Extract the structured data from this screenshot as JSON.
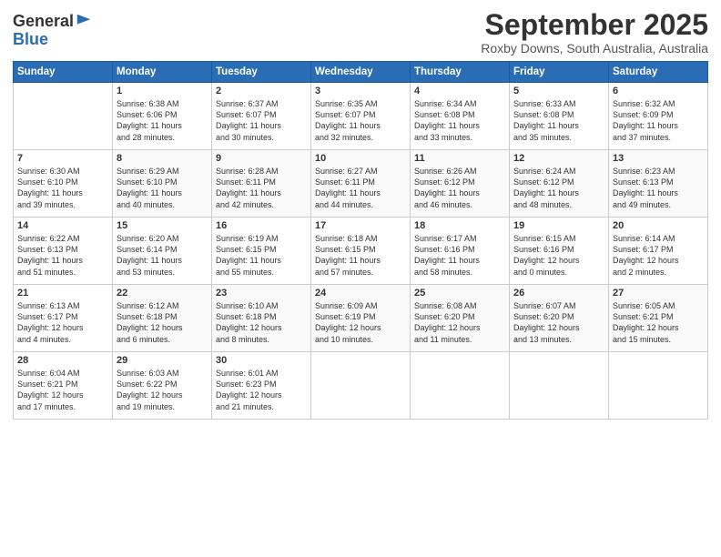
{
  "logo": {
    "general": "General",
    "blue": "Blue"
  },
  "title": "September 2025",
  "location": "Roxby Downs, South Australia, Australia",
  "days_of_week": [
    "Sunday",
    "Monday",
    "Tuesday",
    "Wednesday",
    "Thursday",
    "Friday",
    "Saturday"
  ],
  "weeks": [
    [
      {
        "day": "",
        "info": ""
      },
      {
        "day": "1",
        "info": "Sunrise: 6:38 AM\nSunset: 6:06 PM\nDaylight: 11 hours\nand 28 minutes."
      },
      {
        "day": "2",
        "info": "Sunrise: 6:37 AM\nSunset: 6:07 PM\nDaylight: 11 hours\nand 30 minutes."
      },
      {
        "day": "3",
        "info": "Sunrise: 6:35 AM\nSunset: 6:07 PM\nDaylight: 11 hours\nand 32 minutes."
      },
      {
        "day": "4",
        "info": "Sunrise: 6:34 AM\nSunset: 6:08 PM\nDaylight: 11 hours\nand 33 minutes."
      },
      {
        "day": "5",
        "info": "Sunrise: 6:33 AM\nSunset: 6:08 PM\nDaylight: 11 hours\nand 35 minutes."
      },
      {
        "day": "6",
        "info": "Sunrise: 6:32 AM\nSunset: 6:09 PM\nDaylight: 11 hours\nand 37 minutes."
      }
    ],
    [
      {
        "day": "7",
        "info": "Sunrise: 6:30 AM\nSunset: 6:10 PM\nDaylight: 11 hours\nand 39 minutes."
      },
      {
        "day": "8",
        "info": "Sunrise: 6:29 AM\nSunset: 6:10 PM\nDaylight: 11 hours\nand 40 minutes."
      },
      {
        "day": "9",
        "info": "Sunrise: 6:28 AM\nSunset: 6:11 PM\nDaylight: 11 hours\nand 42 minutes."
      },
      {
        "day": "10",
        "info": "Sunrise: 6:27 AM\nSunset: 6:11 PM\nDaylight: 11 hours\nand 44 minutes."
      },
      {
        "day": "11",
        "info": "Sunrise: 6:26 AM\nSunset: 6:12 PM\nDaylight: 11 hours\nand 46 minutes."
      },
      {
        "day": "12",
        "info": "Sunrise: 6:24 AM\nSunset: 6:12 PM\nDaylight: 11 hours\nand 48 minutes."
      },
      {
        "day": "13",
        "info": "Sunrise: 6:23 AM\nSunset: 6:13 PM\nDaylight: 11 hours\nand 49 minutes."
      }
    ],
    [
      {
        "day": "14",
        "info": "Sunrise: 6:22 AM\nSunset: 6:13 PM\nDaylight: 11 hours\nand 51 minutes."
      },
      {
        "day": "15",
        "info": "Sunrise: 6:20 AM\nSunset: 6:14 PM\nDaylight: 11 hours\nand 53 minutes."
      },
      {
        "day": "16",
        "info": "Sunrise: 6:19 AM\nSunset: 6:15 PM\nDaylight: 11 hours\nand 55 minutes."
      },
      {
        "day": "17",
        "info": "Sunrise: 6:18 AM\nSunset: 6:15 PM\nDaylight: 11 hours\nand 57 minutes."
      },
      {
        "day": "18",
        "info": "Sunrise: 6:17 AM\nSunset: 6:16 PM\nDaylight: 11 hours\nand 58 minutes."
      },
      {
        "day": "19",
        "info": "Sunrise: 6:15 AM\nSunset: 6:16 PM\nDaylight: 12 hours\nand 0 minutes."
      },
      {
        "day": "20",
        "info": "Sunrise: 6:14 AM\nSunset: 6:17 PM\nDaylight: 12 hours\nand 2 minutes."
      }
    ],
    [
      {
        "day": "21",
        "info": "Sunrise: 6:13 AM\nSunset: 6:17 PM\nDaylight: 12 hours\nand 4 minutes."
      },
      {
        "day": "22",
        "info": "Sunrise: 6:12 AM\nSunset: 6:18 PM\nDaylight: 12 hours\nand 6 minutes."
      },
      {
        "day": "23",
        "info": "Sunrise: 6:10 AM\nSunset: 6:18 PM\nDaylight: 12 hours\nand 8 minutes."
      },
      {
        "day": "24",
        "info": "Sunrise: 6:09 AM\nSunset: 6:19 PM\nDaylight: 12 hours\nand 10 minutes."
      },
      {
        "day": "25",
        "info": "Sunrise: 6:08 AM\nSunset: 6:20 PM\nDaylight: 12 hours\nand 11 minutes."
      },
      {
        "day": "26",
        "info": "Sunrise: 6:07 AM\nSunset: 6:20 PM\nDaylight: 12 hours\nand 13 minutes."
      },
      {
        "day": "27",
        "info": "Sunrise: 6:05 AM\nSunset: 6:21 PM\nDaylight: 12 hours\nand 15 minutes."
      }
    ],
    [
      {
        "day": "28",
        "info": "Sunrise: 6:04 AM\nSunset: 6:21 PM\nDaylight: 12 hours\nand 17 minutes."
      },
      {
        "day": "29",
        "info": "Sunrise: 6:03 AM\nSunset: 6:22 PM\nDaylight: 12 hours\nand 19 minutes."
      },
      {
        "day": "30",
        "info": "Sunrise: 6:01 AM\nSunset: 6:23 PM\nDaylight: 12 hours\nand 21 minutes."
      },
      {
        "day": "",
        "info": ""
      },
      {
        "day": "",
        "info": ""
      },
      {
        "day": "",
        "info": ""
      },
      {
        "day": "",
        "info": ""
      }
    ]
  ]
}
